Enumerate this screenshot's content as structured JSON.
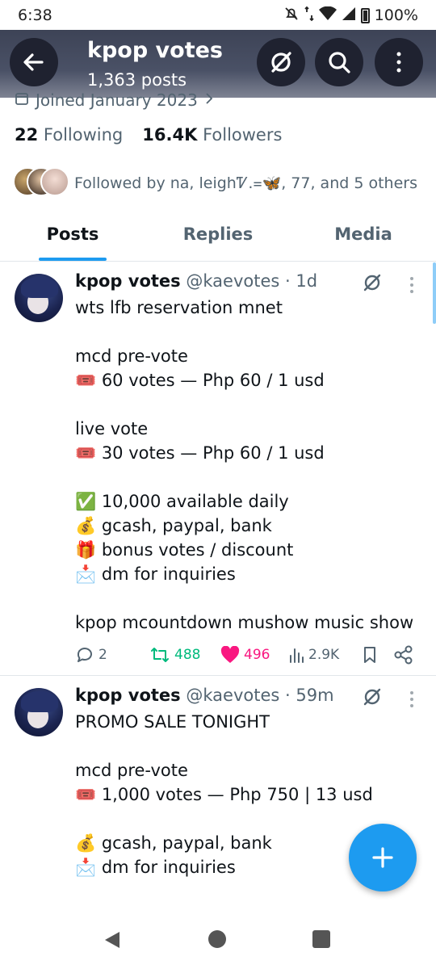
{
  "status_bar": {
    "time": "6:38",
    "battery": "100%"
  },
  "header": {
    "title": "kpop votes",
    "posts_count": "1,363 posts"
  },
  "profile": {
    "joined": "Joined January 2023",
    "following_count": "22",
    "following_label": "Following",
    "followers_count": "16.4K",
    "followers_label": "Followers",
    "followed_by": "Followed by na, leighᏤ.᐀🦋, 77, and 5 others"
  },
  "tabs": [
    {
      "label": "Posts",
      "active": true
    },
    {
      "label": "Replies",
      "active": false
    },
    {
      "label": "Media",
      "active": false
    }
  ],
  "posts": [
    {
      "name": "kpop votes",
      "handle": "@kaevotes",
      "time": "· 1d",
      "lines": [
        "wts lfb reservation mnet",
        "",
        "mcd pre-vote",
        "🎟️ 60 votes — Php 60 / 1 usd",
        "",
        "live vote",
        "🎟️ 30 votes — Php 60 / 1 usd",
        "",
        "✅ 10,000 available daily",
        "💰 gcash, paypal, bank",
        "🎁 bonus votes / discount",
        "📩 dm for inquiries",
        "",
        "kpop mcountdown mushow music show"
      ],
      "replies": "2",
      "reposts": "488",
      "likes": "496",
      "views": "2.9K"
    },
    {
      "name": "kpop votes",
      "handle": "@kaevotes",
      "time": "· 59m",
      "lines": [
        "PROMO SALE TONIGHT",
        "",
        "mcd pre-vote",
        "🎟️ 1,000 votes — Php 750 | 13 usd",
        "",
        "💰 gcash, paypal, bank",
        "📩 dm for inquiries"
      ]
    }
  ],
  "colors": {
    "accent": "#1d9bf0",
    "repost": "#00ba7c",
    "like": "#f91880",
    "header_bg": "#3d4356"
  }
}
